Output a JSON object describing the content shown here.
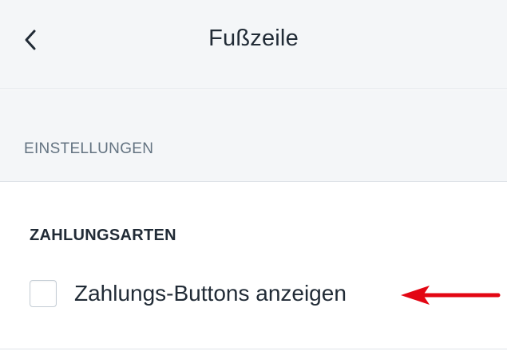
{
  "header": {
    "title": "Fußzeile",
    "back_icon": "chevron-left-icon"
  },
  "section": {
    "label": "EINSTELLUNGEN"
  },
  "payment": {
    "title": "ZAHLUNGSARTEN",
    "checkbox_label": "Zahlungs-Buttons anzeigen",
    "checked": false
  },
  "annotation": {
    "icon": "arrow-left-icon",
    "color": "#e30613"
  },
  "colors": {
    "header_bg": "#f4f6f8",
    "divider": "#dfe3e8",
    "text": "#212b36",
    "muted_text": "#637381"
  }
}
